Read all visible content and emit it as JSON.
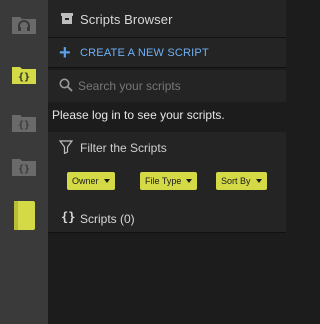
{
  "sidebar": {
    "items": [
      {
        "icon": "headphones-folder-icon",
        "state": "inactive",
        "color": "#6a6a6a"
      },
      {
        "icon": "code-folder-icon",
        "state": "active",
        "color": "#d4d946"
      },
      {
        "icon": "code-folder-icon",
        "state": "inactive",
        "color": "#6a6a6a"
      },
      {
        "icon": "code-folder-icon",
        "state": "inactive",
        "color": "#6a6a6a"
      },
      {
        "icon": "book-icon",
        "state": "active",
        "color": "#d4d946"
      }
    ]
  },
  "header": {
    "title": "Scripts Browser",
    "icon": "trash-box-icon"
  },
  "create": {
    "label": "CREATE A NEW SCRIPT",
    "color": "#6fb0f5"
  },
  "search": {
    "placeholder": "Search your scripts"
  },
  "login_message": "Please log in to see your scripts.",
  "filter": {
    "title": "Filter the Scripts",
    "dropdowns": [
      {
        "label": "Owner"
      },
      {
        "label": "File Type"
      },
      {
        "label": "Sort By"
      }
    ],
    "accent": "#d4d946"
  },
  "scripts": {
    "label": "Scripts (0)",
    "icon_glyph": "{}"
  }
}
